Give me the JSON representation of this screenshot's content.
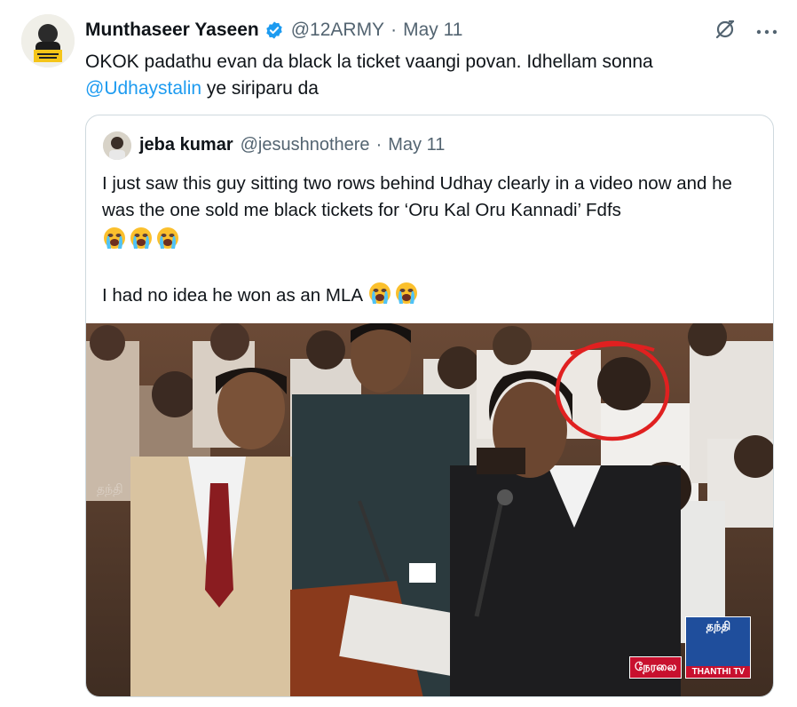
{
  "tweet": {
    "author_name": "Munthaseer Yaseen",
    "author_handle": "@12ARMY",
    "separator": "·",
    "date": "May 11",
    "text_line1": "OKOK padathu evan da black la ticket vaangi povan. Idhellam sonna",
    "mention": "@Udhaystalin",
    "text_line2_rest": " ye siriparu da"
  },
  "quoted": {
    "author_name": "jeba kumar",
    "author_handle": "@jesushnothere",
    "separator": "·",
    "date": "May 11",
    "para1": "I just saw this guy sitting two rows behind Udhay clearly in a video now and he was the one sold me black tickets for ‘Oru Kal Oru Kannadi’ Fdfs",
    "para2": "I had no idea he won as an MLA",
    "emoji_name": "loudly-crying-face"
  },
  "media": {
    "logo_tag": "நேரலை",
    "logo_top": "தந்தி",
    "logo_bottom": "THANTHI TV"
  },
  "colors": {
    "link": "#1d9bf0",
    "verified": "#1d9bf0",
    "muted": "#536471",
    "circle": "#e02020"
  }
}
